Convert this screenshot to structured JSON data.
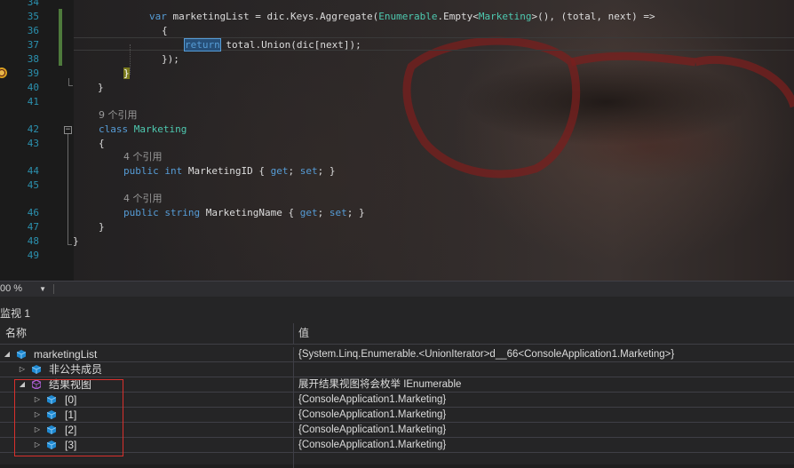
{
  "editor": {
    "line_numbers": [
      "34",
      "35",
      "36",
      "37",
      "38",
      "39",
      "40",
      "41",
      "42",
      "43",
      "44",
      "45",
      "46",
      "47",
      "48",
      "49"
    ],
    "line35": {
      "kw_var": "var",
      "a": " marketingList = dic.Keys.Aggregate(",
      "t1": "Enumerable",
      "b": ".Empty<",
      "t2": "Marketing",
      "c": ">(), (total, next) =>"
    },
    "line36": {
      "text": "{"
    },
    "line37": {
      "kw_return": "return",
      "rest": " total.Union(dic[next]);"
    },
    "line38": {
      "text": "});"
    },
    "line39": {
      "text": "}"
    },
    "line40": {
      "text": "}"
    },
    "ref_class": "9 个引用",
    "line42": {
      "kw_class": "class",
      "name": "Marketing"
    },
    "line43": {
      "text": "{"
    },
    "ref_prop1": "4 个引用",
    "line44": {
      "kw_public": "public",
      "kw_int": "int",
      "name": " MarketingID { ",
      "kw_get": "get",
      "semi1": "; ",
      "kw_set": "set",
      "end": "; }"
    },
    "ref_prop2": "4 个引用",
    "line46": {
      "kw_public": "public",
      "kw_string": "string",
      "name": " MarketingName { ",
      "kw_get": "get",
      "semi1": "; ",
      "kw_set": "set",
      "end": "; }"
    },
    "line47": {
      "text": "}"
    },
    "line48": {
      "text": "}"
    }
  },
  "zoombar": {
    "zoom": "00 %"
  },
  "watch": {
    "title": "监视 1",
    "col_name": "名称",
    "col_value": "值",
    "rows": [
      {
        "name": "marketingList",
        "value": "{System.Linq.Enumerable.<UnionIterator>d__66<ConsoleApplication1.Marketing>}"
      },
      {
        "name": "非公共成员",
        "value": ""
      },
      {
        "name": "结果视图",
        "value": "展开结果视图将会枚举 IEnumerable"
      },
      {
        "name": "[0]",
        "value": "{ConsoleApplication1.Marketing}"
      },
      {
        "name": "[1]",
        "value": "{ConsoleApplication1.Marketing}"
      },
      {
        "name": "[2]",
        "value": "{ConsoleApplication1.Marketing}"
      },
      {
        "name": "[3]",
        "value": "{ConsoleApplication1.Marketing}"
      }
    ]
  },
  "colors": {
    "keyword": "#569cd6",
    "type": "#4ec9b0",
    "line_number": "#2b91af",
    "highlight_box": "#d9302c"
  }
}
